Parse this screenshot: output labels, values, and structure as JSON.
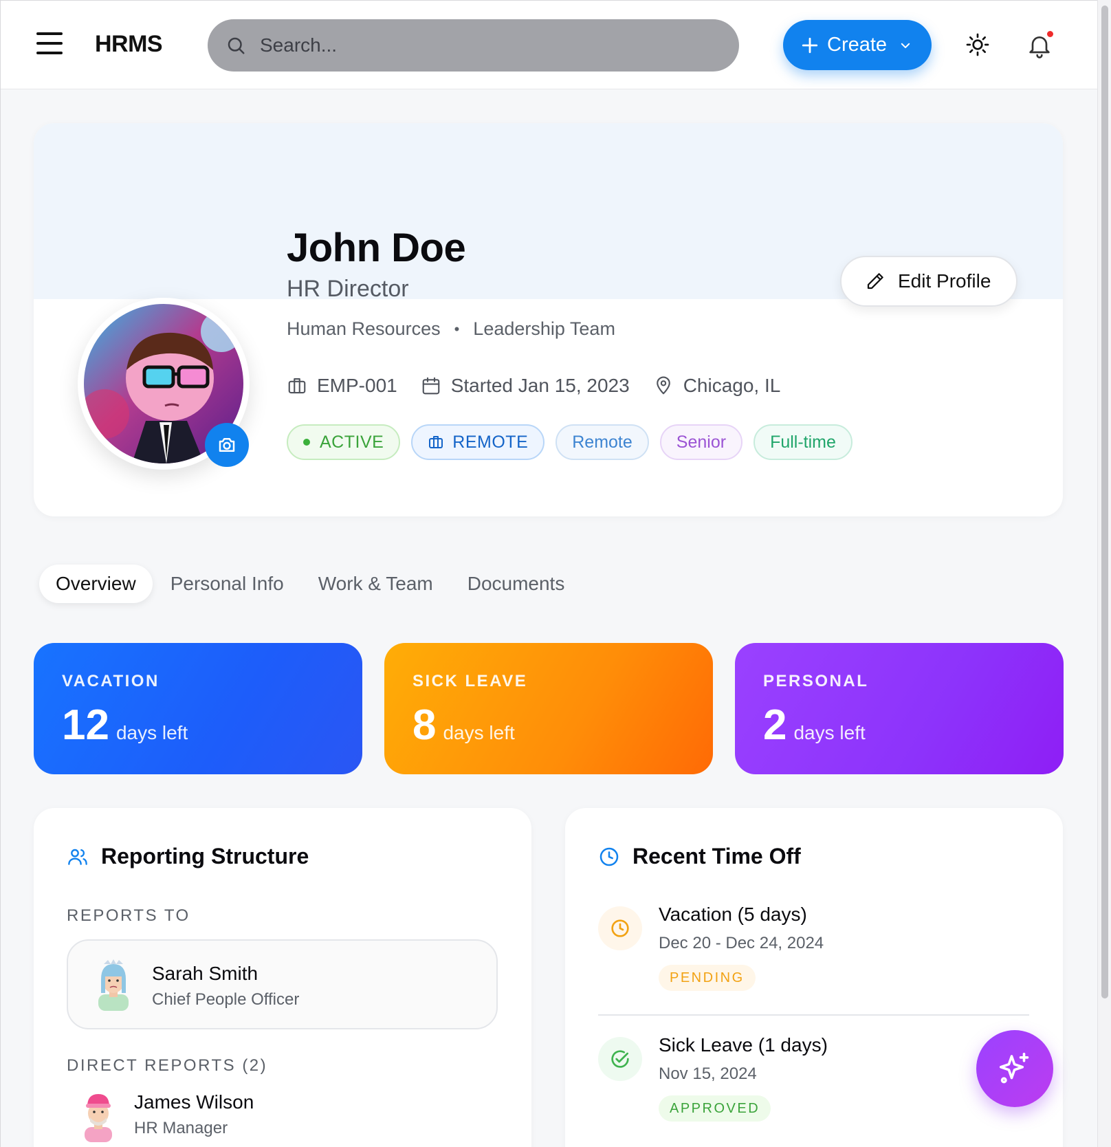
{
  "header": {
    "app_name": "HRMS",
    "search_placeholder": "Search...",
    "create_label": "Create",
    "icons": [
      "menu-icon",
      "search-icon",
      "plus-icon",
      "chevron-down-icon",
      "sun-icon",
      "bell-icon"
    ],
    "notification_dot_color": "#ef2b2b",
    "accent_color": "#1182ee"
  },
  "profile": {
    "name": "John Doe",
    "title": "HR Director",
    "department": "Human Resources",
    "separator": "•",
    "team": "Leadership Team",
    "employee_id": "EMP-001",
    "start": "Started Jan 15, 2023",
    "location": "Chicago, IL",
    "edit_label": "Edit Profile",
    "tags": {
      "status": "ACTIVE",
      "work_mode": "REMOTE",
      "location_type": "Remote",
      "level": "Senior",
      "employment": "Full-time"
    }
  },
  "tabs": [
    {
      "label": "Overview",
      "active": true
    },
    {
      "label": "Personal Info",
      "active": false
    },
    {
      "label": "Work & Team",
      "active": false
    },
    {
      "label": "Documents",
      "active": false
    }
  ],
  "leave_balances": [
    {
      "label": "VACATION",
      "value": "12",
      "unit": "days left",
      "color": "#1d5dfa"
    },
    {
      "label": "SICK LEAVE",
      "value": "8",
      "unit": "days left",
      "color": "#ff8d08"
    },
    {
      "label": "PERSONAL",
      "value": "2",
      "unit": "days left",
      "color": "#8d33fb"
    }
  ],
  "reporting": {
    "title": "Reporting Structure",
    "reports_to_label": "REPORTS TO",
    "manager": {
      "name": "Sarah Smith",
      "role": "Chief People Officer"
    },
    "direct_reports_label": "DIRECT REPORTS (2)",
    "direct_reports": [
      {
        "name": "James Wilson",
        "role": "HR Manager"
      }
    ]
  },
  "time_off": {
    "title": "Recent Time Off",
    "items": [
      {
        "title": "Vacation (5 days)",
        "dates": "Dec 20 - Dec 24, 2024",
        "status": "PENDING",
        "status_color": "#f2a213"
      },
      {
        "title": "Sick Leave (1 days)",
        "dates": "Nov 15, 2024",
        "status": "APPROVED",
        "status_color": "#3aa33a"
      }
    ]
  }
}
